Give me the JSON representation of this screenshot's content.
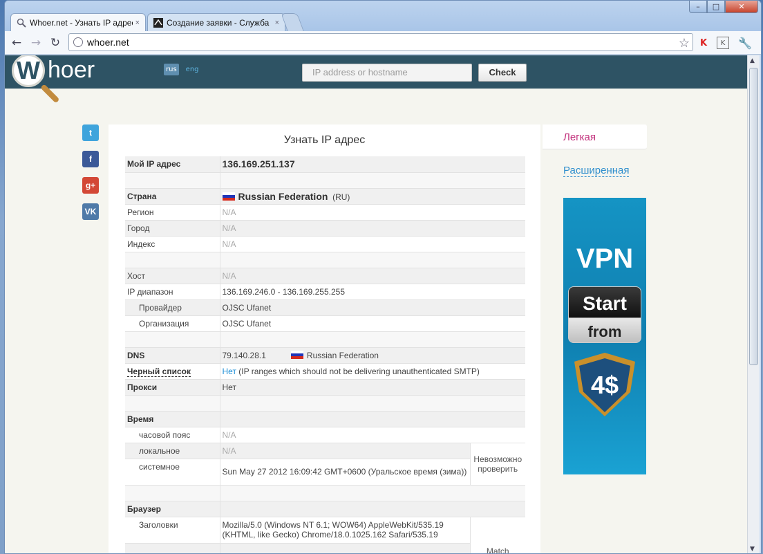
{
  "browser": {
    "tabs": [
      {
        "title": "Whoer.net - Узнать IP адрес",
        "close": "×"
      },
      {
        "title": "Создание заявки - Служба",
        "close": "×"
      }
    ],
    "address": "whoer.net",
    "window_controls": {
      "min": "–",
      "max": "□",
      "close": "✕"
    }
  },
  "site": {
    "logo": "Whoer",
    "logo_letter": "W",
    "langs": [
      "rus",
      "eng"
    ],
    "search_placeholder": "IP address or hostname",
    "check_label": "Check",
    "social": [
      "twitter",
      "facebook",
      "google-plus",
      "vk"
    ]
  },
  "main": {
    "title": "Узнать IP адрес",
    "my_ip_label": "Мой IP адрес",
    "my_ip": "136.169.251.137",
    "country_label": "Страна",
    "country": "Russian Federation",
    "country_code": "(RU)",
    "region_label": "Регион",
    "city_label": "Город",
    "index_label": "Индекс",
    "host_label": "Хост",
    "na": "N/A",
    "ip_range_label": "IP диапазон",
    "ip_range": "136.169.246.0 - 136.169.255.255",
    "provider_label": "Провайдер",
    "provider": "OJSC Ufanet",
    "org_label": "Организация",
    "org": "OJSC Ufanet",
    "dns_label": "DNS",
    "dns_ip": "79.140.28.1",
    "dns_country": "Russian Federation",
    "blacklist_label": "Черный список",
    "blacklist_value": "Нет",
    "blacklist_note": "(IP ranges which should not be delivering unauthenticated SMTP)",
    "proxy_label": "Прокси",
    "proxy_value": "Нет",
    "time_label": "Время",
    "tz_label": "часовой пояс",
    "local_label": "локальное",
    "system_label": "системное",
    "system_value": "Sun May 27 2012 16:09:42 GMT+0600 (Уральское время (зима))",
    "cannot_check": "Невозможно проверить",
    "browser_label": "Браузер",
    "headers_label": "Заголовки",
    "headers_value": "Mozilla/5.0 (Windows NT 6.1; WOW64) AppleWebKit/535.19 (KHTML, like Gecko) Chrome/18.0.1025.162 Safari/535.19",
    "match": "Match"
  },
  "right": {
    "easy": "Легкая",
    "advanced": "Расширенная",
    "ad": {
      "vpn": "VPN",
      "start": "Start",
      "from": "from",
      "price": "4$"
    }
  }
}
